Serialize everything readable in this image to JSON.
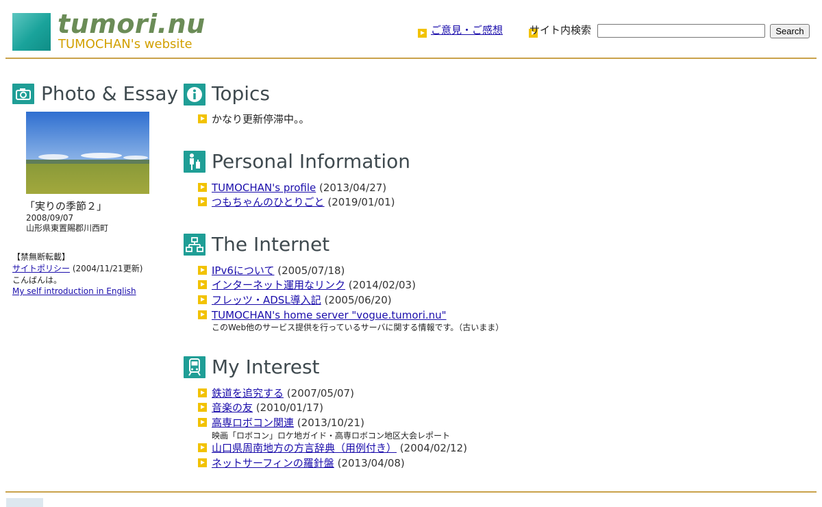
{
  "header": {
    "site_title": "tumori.nu",
    "site_subtitle": "TUMOCHAN's website",
    "feedback_link": "ご意見・ご感想",
    "search_label": "サイト内検索",
    "search_value": "",
    "search_button": "Search"
  },
  "photo_essay": {
    "heading": "Photo & Essay",
    "caption_title": "「実りの季節２」",
    "date": "2008/09/07",
    "location": "山形県東置賜郡川西町",
    "copyright_note": "【禁無断転載】",
    "policy_link": "サイトポリシー",
    "policy_update": "(2004/11/21更新)",
    "greeting": "こんばんは。",
    "english_link": "My self introduction in English"
  },
  "topics": {
    "heading": "Topics",
    "items": [
      {
        "text": "かなり更新停滞中。。"
      }
    ]
  },
  "personal": {
    "heading": "Personal Information",
    "items": [
      {
        "link": "TUMOCHAN's profile",
        "date": "(2013/04/27)"
      },
      {
        "link": "つもちゃんのひとりごと",
        "date": "(2019/01/01)"
      }
    ]
  },
  "internet": {
    "heading": "The Internet",
    "items": [
      {
        "link": "IPv6について",
        "date": "(2005/07/18)",
        "note": ""
      },
      {
        "link": "インターネット運用なリンク",
        "date": "(2014/02/03)",
        "note": ""
      },
      {
        "link": "フレッツ・ADSL導入記",
        "date": "(2005/06/20)",
        "note": ""
      },
      {
        "link": "TUMOCHAN's home server \"vogue.tumori.nu\"",
        "date": "",
        "note": "このWeb他のサービス提供を行っているサーバに関する情報です。（古いまま）"
      }
    ]
  },
  "interest": {
    "heading": "My Interest",
    "items": [
      {
        "link": "鉄道を追究する",
        "date": "(2007/05/07)",
        "note": ""
      },
      {
        "link": "音楽の友",
        "date": "(2010/01/17)",
        "note": ""
      },
      {
        "link": "高専ロボコン関連",
        "date": "(2013/10/21)",
        "note": "映画「ロボコン」ロケ地ガイド・高専ロボコン地区大会レポート"
      },
      {
        "link": "山口県周南地方の方言辞典（用例付き）",
        "date": "(2004/02/12)",
        "note": ""
      },
      {
        "link": "ネットサーフィンの羅針盤",
        "date": "(2013/04/08)",
        "note": ""
      }
    ]
  },
  "colors": {
    "accent_teal": "#1f9e96",
    "bullet_yellow": "#f2c200",
    "rule_gold": "#c9a24a",
    "logo_green": "#6b8c57",
    "subtitle_gold": "#d2a000"
  }
}
